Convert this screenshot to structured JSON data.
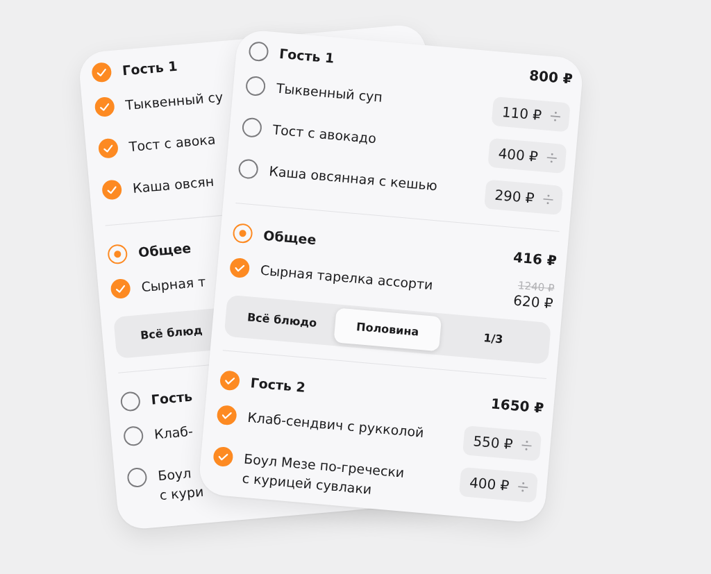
{
  "cards": [
    {
      "sections": [
        {
          "kind": "guest",
          "title": "Гость 1",
          "checked": true,
          "items": [
            {
              "name": "Тыквенный су",
              "checked": true
            },
            {
              "name": "Тост с авока",
              "checked": true
            },
            {
              "name": "Каша овсян",
              "checked": true
            }
          ]
        },
        {
          "kind": "shared",
          "title": "Общее",
          "checked": true,
          "items": [
            {
              "name": "Сырная т",
              "checked": true
            }
          ],
          "split_options": [
            {
              "label": "Всё блюд",
              "selected": false
            }
          ]
        },
        {
          "kind": "guest",
          "title": "Гость",
          "checked": false,
          "items": [
            {
              "name": "Клаб-",
              "checked": false
            },
            {
              "name": "Боул\nс кури",
              "checked": false
            }
          ]
        }
      ]
    },
    {
      "sections": [
        {
          "kind": "guest",
          "title": "Гость 1",
          "checked": false,
          "total": "800 ₽",
          "items": [
            {
              "name": "Тыквенный суп",
              "checked": false,
              "price": "110 ₽"
            },
            {
              "name": "Тост с авокадо",
              "checked": false,
              "price": "400 ₽"
            },
            {
              "name": "Каша овсянная с кешью",
              "checked": false,
              "price": "290 ₽"
            }
          ]
        },
        {
          "kind": "shared",
          "title": "Общее",
          "checked": true,
          "total": "416 ₽",
          "items": [
            {
              "name": "Сырная тарелка ассорти",
              "checked": true,
              "old_price": "1240 ₽",
              "price": "620 ₽"
            }
          ],
          "split_options": [
            {
              "label": "Всё блюдо",
              "selected": false
            },
            {
              "label": "Половина",
              "selected": true
            },
            {
              "label": "1/3",
              "selected": false
            }
          ]
        },
        {
          "kind": "guest",
          "title": "Гость 2",
          "checked": true,
          "total": "1650 ₽",
          "items": [
            {
              "name": "Клаб-сендвич с рукколой",
              "checked": true,
              "price": "550 ₽"
            },
            {
              "name": "Боул Мезе по-гречески\nс курицей сувлаки",
              "checked": true,
              "price": "400 ₽"
            }
          ]
        }
      ]
    }
  ]
}
